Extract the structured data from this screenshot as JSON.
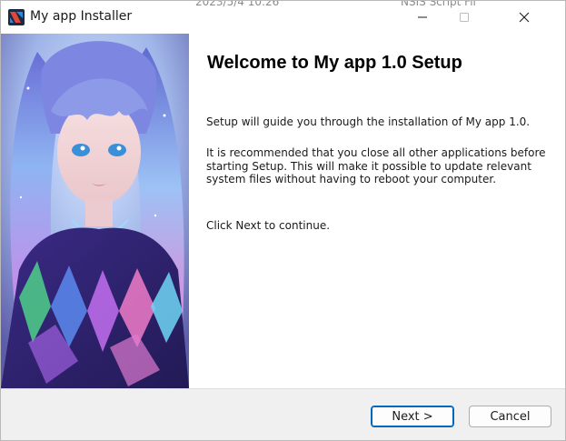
{
  "window": {
    "title": "My app Installer",
    "behind_text_left": "2023/5/4 10:26",
    "behind_text_right": "NSIS Script Fil"
  },
  "content": {
    "heading": "Welcome to My app 1.0 Setup",
    "paragraph1": "Setup will guide you through the installation of My app 1.0.",
    "paragraph2": "It is recommended that you close all other applications before starting Setup. This will make it possible to update relevant system files without having to reboot your computer.",
    "paragraph3": "Click Next to continue."
  },
  "buttons": {
    "next_label": "Next >",
    "cancel_label": "Cancel"
  },
  "icons": {
    "app": "nsis-installer-icon",
    "minimize": "minimize-icon",
    "maximize": "maximize-icon",
    "close": "close-icon"
  },
  "colors": {
    "accent": "#0067c0",
    "footer_bg": "#f0f0f0"
  }
}
